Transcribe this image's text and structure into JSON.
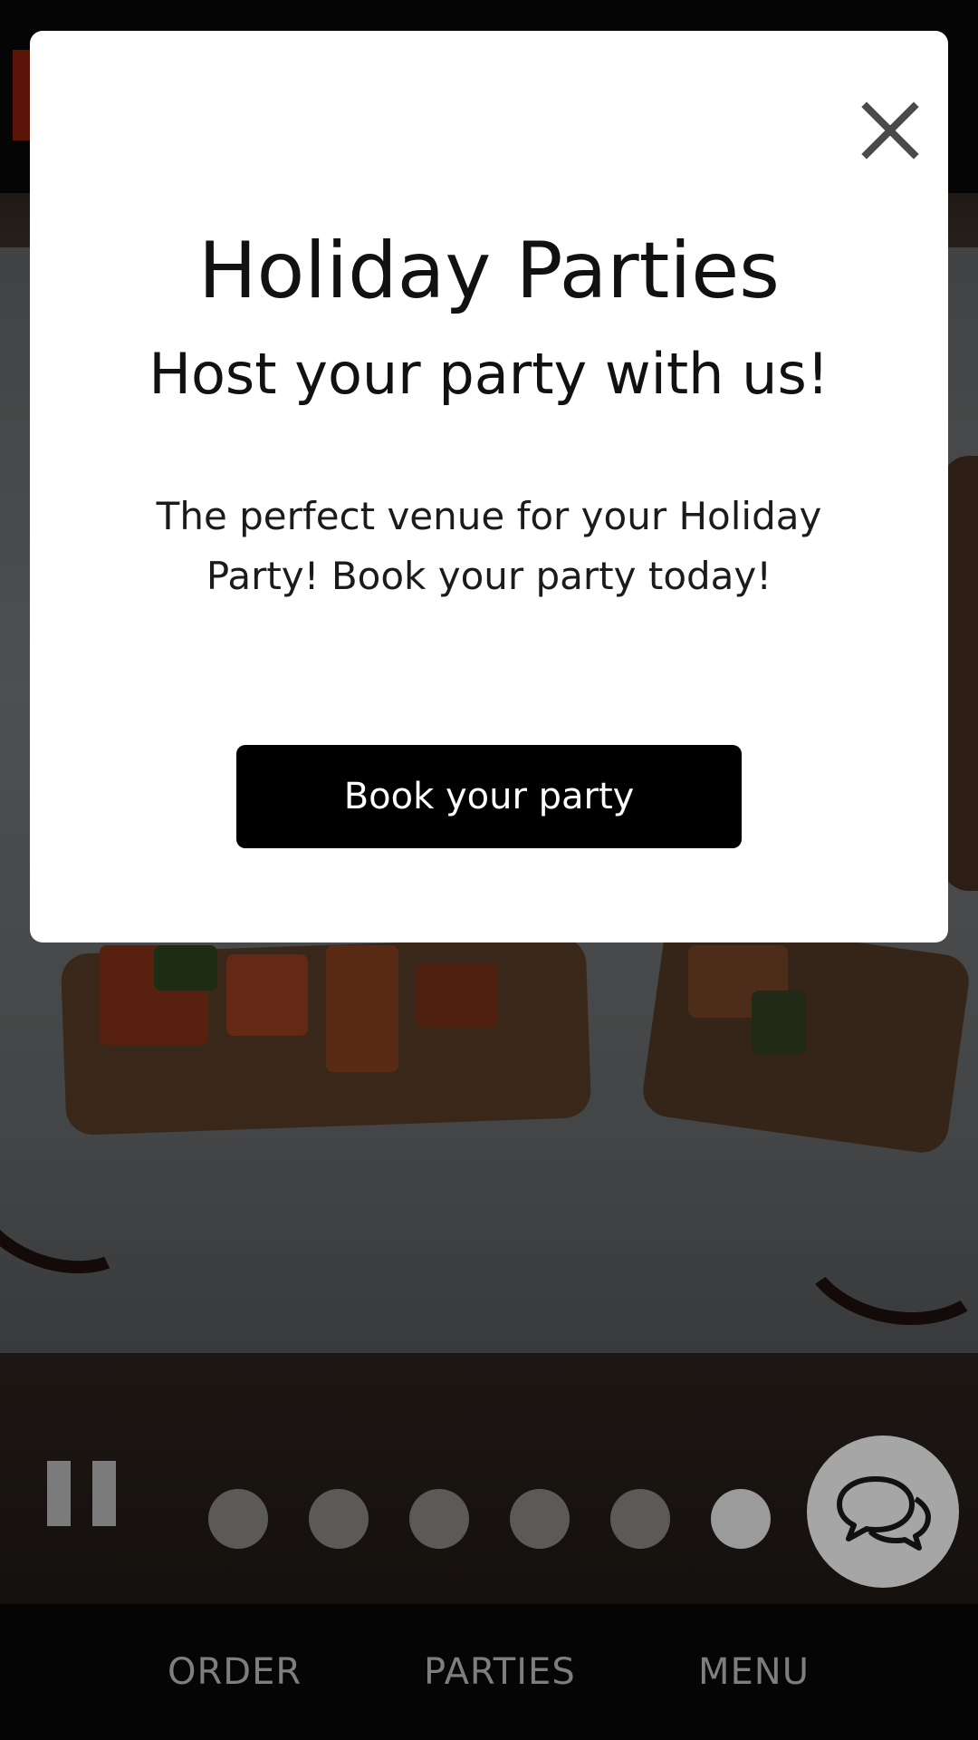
{
  "modal": {
    "title": "Holiday Parties",
    "subtitle": "Host your party with us!",
    "body": "The perfect venue for your Holiday Party! Book your party today!",
    "cta_label": "Book your party",
    "close_icon": "close-icon"
  },
  "carousel": {
    "pause_icon": "pause-icon",
    "slide_count": 6,
    "active_slide": 6
  },
  "chat": {
    "icon": "chat-bubbles-icon"
  },
  "bottom_nav": {
    "order": "ORDER",
    "parties": "PARTIES",
    "menu": "MENU"
  },
  "colors": {
    "cta_background": "#000000",
    "modal_background": "#ffffff",
    "nav_text": "#7e7e7e"
  }
}
